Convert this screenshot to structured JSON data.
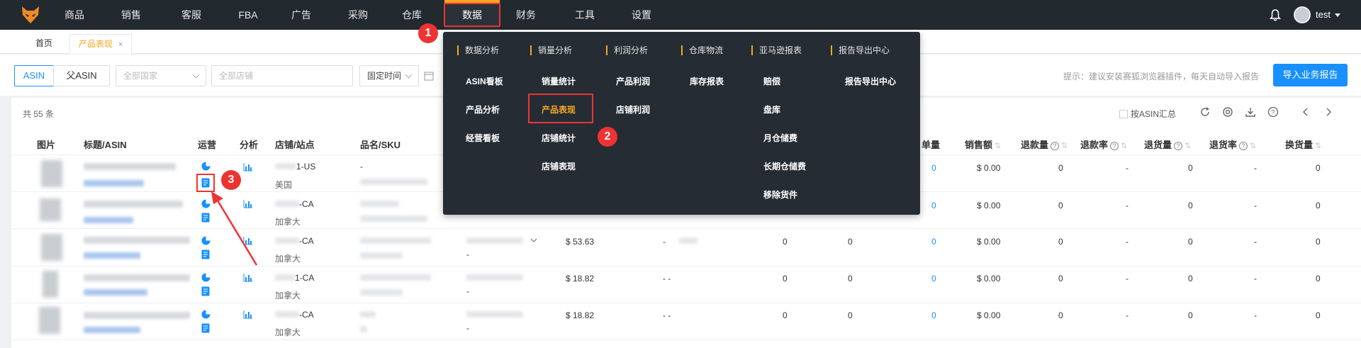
{
  "nav": {
    "items": [
      "商品",
      "销售",
      "客服",
      "FBA",
      "广告",
      "采购",
      "仓库",
      "数据",
      "财务",
      "工具",
      "设置"
    ],
    "active": "数据",
    "user": "test"
  },
  "tabs": {
    "home": "首页",
    "current": "产品表现",
    "close": "×"
  },
  "filters": {
    "asin": "ASIN",
    "parent_asin": "父ASIN",
    "country": "全部国家",
    "store": "全部店铺",
    "time": "固定时间",
    "tip": "提示：建议安装赛狐浏览器插件，每天自动导入报告",
    "import_button": "导入业务报告"
  },
  "table": {
    "count": "共 55 条",
    "asin_summary": "按ASIN汇总",
    "headers": {
      "image": "图片",
      "title": "标题/ASIN",
      "ops": "运营",
      "analysis": "分析",
      "store": "店铺/站点",
      "name": "品名/SKU",
      "units": "单量",
      "sales": "销售额",
      "refunds": "退款量",
      "refund_rate": "退款率",
      "returns": "退货量",
      "return_rate": "退货率",
      "exchange": "换货量"
    },
    "rows": [
      {
        "store": "1-US",
        "site": "美国",
        "name": "-",
        "price": "",
        "units": "0",
        "sales": "$ 0.00",
        "refunds": "0",
        "refund_rate": "-",
        "returns": "0",
        "return_rate": "-",
        "exchange": "0"
      },
      {
        "store": "-CA",
        "site": "加拿大",
        "name": "",
        "price": "",
        "units": "0",
        "sales": "$ 0.00",
        "refunds": "0",
        "refund_rate": "-",
        "returns": "0",
        "return_rate": "-",
        "exchange": "0"
      },
      {
        "store": "-CA",
        "site": "加拿大",
        "name": "",
        "price": "$ 53.63",
        "c7": "-",
        "c8": "0",
        "c9": "0",
        "units": "0",
        "sales": "$ 0.00",
        "refunds": "0",
        "refund_rate": "-",
        "returns": "0",
        "return_rate": "-",
        "exchange": "0"
      },
      {
        "store": "1-CA",
        "site": "加拿大",
        "name": "",
        "price": "$ 18.82",
        "c7": "-  -",
        "c8": "0",
        "c9": "0",
        "units": "0",
        "sales": "$ 0.00",
        "refunds": "0",
        "refund_rate": "-",
        "returns": "0",
        "return_rate": "-",
        "exchange": "0"
      },
      {
        "store": "-CA",
        "site": "加拿大",
        "name": "",
        "price": "$ 18.82",
        "c7": "-  -",
        "c8": "0",
        "c9": "0",
        "units": "0",
        "sales": "$ 0.00",
        "refunds": "0",
        "refund_rate": "-",
        "returns": "0",
        "return_rate": "-",
        "exchange": "0"
      }
    ]
  },
  "menu": {
    "columns": [
      {
        "head": "数据分析",
        "items": [
          "ASIN看板",
          "产品分析",
          "经营看板"
        ]
      },
      {
        "head": "销量分析",
        "items": [
          "销量统计",
          "产品表现",
          "店铺统计",
          "店铺表现"
        ]
      },
      {
        "head": "利润分析",
        "items": [
          "产品利润",
          "店铺利润"
        ]
      },
      {
        "head": "仓库物流",
        "items": [
          "库存报表"
        ]
      },
      {
        "head": "亚马逊报表",
        "items": [
          "赔偿",
          "盘库",
          "月仓储费",
          "长期仓储费",
          "移除货件"
        ]
      },
      {
        "head": "报告导出中心",
        "items": [
          "报告导出中心"
        ]
      }
    ],
    "current": "产品表现"
  },
  "annotations": [
    "1",
    "2",
    "3"
  ],
  "colors": {
    "nav_bg": "#22292f",
    "accent": "#f5a623",
    "primary": "#1890ff",
    "highlight": "#ee3333"
  }
}
